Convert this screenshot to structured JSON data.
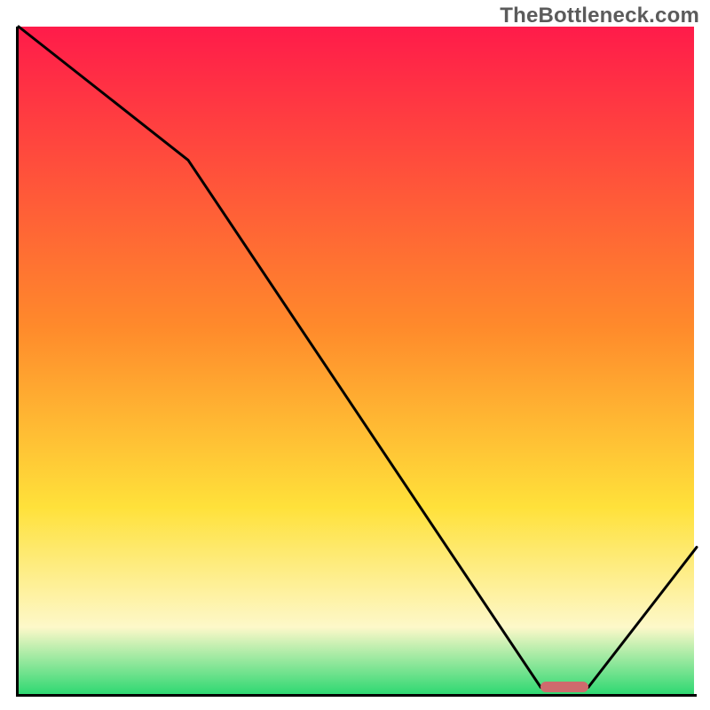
{
  "watermark": "TheBottleneck.com",
  "colors": {
    "gradient_top": "#ff1b4a",
    "gradient_mid1": "#ff8a2b",
    "gradient_mid2": "#ffe13a",
    "gradient_pale": "#fdf8c9",
    "gradient_green": "#2fd872",
    "curve": "#000000",
    "axis": "#000000",
    "marker": "#cf6a6d"
  },
  "chart_data": {
    "type": "line",
    "title": "",
    "xlabel": "",
    "ylabel": "",
    "xlim": [
      0,
      100
    ],
    "ylim": [
      0,
      100
    ],
    "x": [
      0,
      25,
      77,
      84,
      100
    ],
    "values": [
      100,
      80,
      1,
      1,
      22
    ],
    "marker_range_x": [
      77,
      84
    ],
    "marker_y": 1,
    "gradient_stops": [
      {
        "offset": 0.0,
        "color": "#ff1b4a"
      },
      {
        "offset": 0.45,
        "color": "#ff8a2b"
      },
      {
        "offset": 0.72,
        "color": "#ffe13a"
      },
      {
        "offset": 0.9,
        "color": "#fdf8c9"
      },
      {
        "offset": 1.0,
        "color": "#2fd872"
      }
    ]
  }
}
